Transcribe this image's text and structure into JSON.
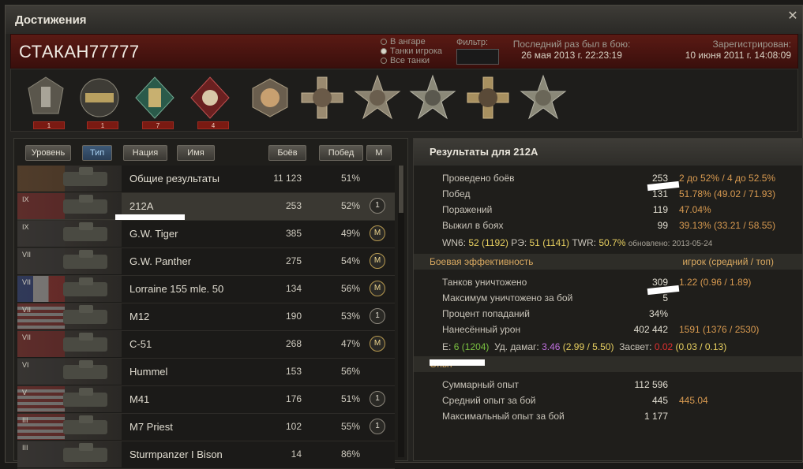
{
  "window": {
    "title": "Достижения",
    "close": "✕"
  },
  "header": {
    "player": "СТАКАН77777",
    "radios": [
      "В ангаре",
      "Танки игрока",
      "Все танки"
    ],
    "radio_selected": 1,
    "filter_label": "Фильтр:",
    "lastseen_label": "Последний раз был в бою:",
    "lastseen_value": "26 мая 2013 г. 22:23:19",
    "registered_label": "Зарегистрирован:",
    "registered_value": "10 июня 2011 г. 14:08:09"
  },
  "medals": [
    {
      "icon": "medal-kolobanov-icon",
      "count": "1"
    },
    {
      "icon": "medal-pool-icon",
      "count": "1"
    },
    {
      "icon": "medal-raseiniai-icon",
      "count": "7"
    },
    {
      "icon": "medal-lafayette-icon",
      "count": "4"
    },
    {
      "icon": "medal-bruno-icon",
      "count": ""
    },
    {
      "icon": "medal-cross-1-icon",
      "count": ""
    },
    {
      "icon": "medal-star-1-icon",
      "count": ""
    },
    {
      "icon": "medal-star-2-icon",
      "count": ""
    },
    {
      "icon": "medal-cross-2-icon",
      "count": ""
    },
    {
      "icon": "medal-star-3-icon",
      "count": ""
    }
  ],
  "sort": {
    "level": "Уровень",
    "type": "Тип",
    "nation": "Нация",
    "name": "Имя",
    "battles": "Боёв",
    "wins": "Побед",
    "mastery": "М"
  },
  "tanks": [
    {
      "tier": "",
      "name": "Общие результаты",
      "battles": "11 123",
      "wins": "51%",
      "badge": ""
    },
    {
      "tier": "IX",
      "name": "212A",
      "battles": "253",
      "wins": "52%",
      "badge": "1"
    },
    {
      "tier": "IX",
      "name": "G.W. Tiger",
      "battles": "385",
      "wins": "49%",
      "badge": "M"
    },
    {
      "tier": "VII",
      "name": "G.W. Panther",
      "battles": "275",
      "wins": "54%",
      "badge": "M"
    },
    {
      "tier": "VII",
      "name": "Lorraine 155 mle. 50",
      "battles": "134",
      "wins": "56%",
      "badge": "M"
    },
    {
      "tier": "VII",
      "name": "M12",
      "battles": "190",
      "wins": "53%",
      "badge": "1"
    },
    {
      "tier": "VII",
      "name": "С-51",
      "battles": "268",
      "wins": "47%",
      "badge": "M"
    },
    {
      "tier": "VI",
      "name": "Hummel",
      "battles": "153",
      "wins": "56%",
      "badge": ""
    },
    {
      "tier": "V",
      "name": "M41",
      "battles": "176",
      "wins": "51%",
      "badge": "1"
    },
    {
      "tier": "III",
      "name": "M7 Priest",
      "battles": "102",
      "wins": "55%",
      "badge": "1"
    },
    {
      "tier": "III",
      "name": "Sturmpanzer I Bison",
      "battles": "14",
      "wins": "86%",
      "badge": ""
    }
  ],
  "results": {
    "title": "Результаты для 212A",
    "battles": {
      "label": "Проведено боёв",
      "value": "253",
      "ext": "2 до 52% / 4 до 52.5%"
    },
    "wins": {
      "label": "Побед",
      "value": "131",
      "ext": "51.78% (49.02 / 71.93)"
    },
    "losses": {
      "label": "Поражений",
      "value": "119",
      "ext": "47.04%"
    },
    "survived": {
      "label": "Выжил в боях",
      "value": "99",
      "ext": "39.13% (33.21 / 58.55)"
    },
    "wn6_label": "WN6:",
    "wn6_val": "52",
    "wn6_ext": "(1192)",
    "re_label": "РЭ:",
    "re_val": "51",
    "re_ext": "(1141)",
    "twr_label": "TWR:",
    "twr_val": "50.7%",
    "updated": "обновлено: 2013-05-24",
    "sec_eff": "Боевая эффективность",
    "sec_eff_right": "игрок (средний / топ)",
    "killed": {
      "label": "Танков уничтожено",
      "value": "309",
      "ext": "1.22 (0.96 / 1.89)"
    },
    "maxkilled": {
      "label": "Максимум уничтожено за бой",
      "value": "5",
      "ext": ""
    },
    "hitpct": {
      "label": "Процент попаданий",
      "value": "34%",
      "ext": ""
    },
    "damage": {
      "label": "Нанесённый урон",
      "value": "402 442",
      "ext": "1591 (1376 / 2530)"
    },
    "e_label": "Е:",
    "e_val": "6",
    "e_ext": "(1204)",
    "dmg_label": "Уд. дамаг:",
    "dmg_val": "3.46",
    "dmg_ext": "(2.99 / 5.50)",
    "spot_label": "Засвет:",
    "spot_val": "0.02",
    "spot_ext": "(0.03 / 0.13)",
    "sec_exp": "Опыт",
    "totalexp": {
      "label": "Суммарный опыт",
      "value": "112 596",
      "ext": ""
    },
    "avgexp": {
      "label": "Средний опыт за бой",
      "value": "445",
      "ext": "445.04"
    },
    "maxexp": {
      "label": "Максимальный опыт за бой",
      "value": "1 177",
      "ext": ""
    }
  }
}
